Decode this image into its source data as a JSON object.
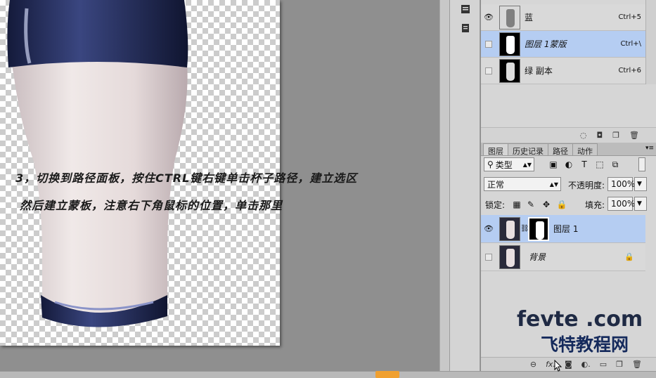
{
  "tutorial": {
    "line1": "3，切换到路径面板，按住CTRL键右键单击杯子路径，建立选区",
    "line2": "然后建立蒙板，注意右下角鼠标的位置，单击那里"
  },
  "channels": {
    "rows": [
      {
        "label": "蓝",
        "shortcut": "Ctrl+5",
        "selected": false
      },
      {
        "label": "图层 1蒙版",
        "shortcut": "Ctrl+\\",
        "selected": true
      },
      {
        "label": "绿 副本",
        "shortcut": "Ctrl+6",
        "selected": false
      }
    ]
  },
  "layers_panel": {
    "tabs": [
      "图层",
      "历史记录",
      "路径",
      "动作"
    ],
    "active_tab": "图层",
    "filter_label": "类型",
    "blend_mode": "正常",
    "opacity_label": "不透明度:",
    "opacity_value": "100%",
    "lock_label": "锁定:",
    "fill_label": "填充:",
    "fill_value": "100%",
    "layers": [
      {
        "name": "图层 1",
        "selected": true
      },
      {
        "name": "背景",
        "selected": false
      }
    ]
  },
  "watermark": {
    "top": "fevte .com",
    "bottom": "飞特教程网"
  },
  "colors": {
    "selection": "#b5cdf2",
    "panel_bg": "#d6d6d6",
    "canvas_bg": "#8f8f8f",
    "watermark_red": "#c0392b",
    "watermark_navy": "#152a5c"
  },
  "icons": {
    "dock": [
      "panel-icon",
      "notes-icon"
    ],
    "layer_footer": [
      "link-icon",
      "fx-icon",
      "add-mask-icon",
      "adjustment-icon",
      "folder-icon",
      "new-layer-icon",
      "trash-icon"
    ],
    "channel_footer": [
      "load-selection-icon",
      "save-mask-icon",
      "new-channel-icon",
      "trash-icon"
    ]
  }
}
